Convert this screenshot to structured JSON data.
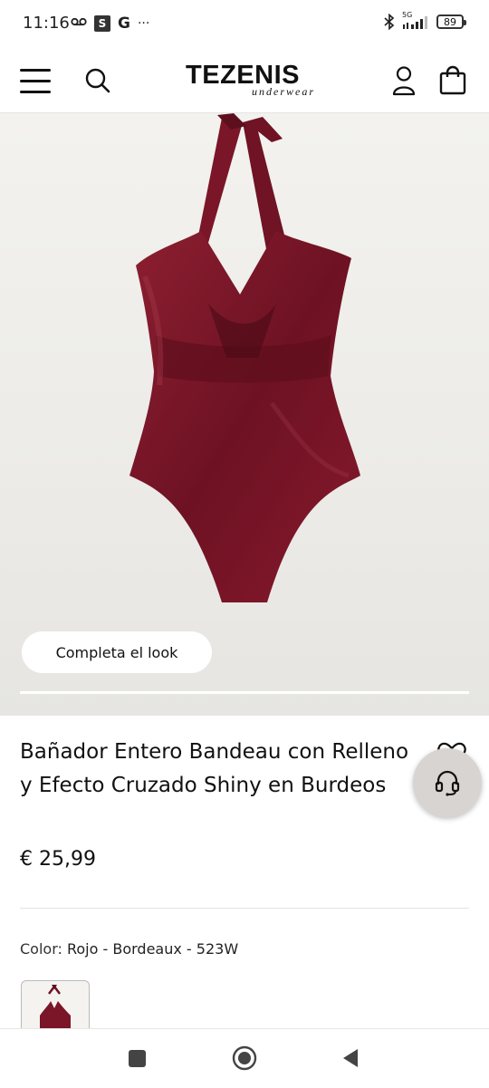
{
  "status_bar": {
    "time": "11:16",
    "icons_left": [
      "voicemail-icon",
      "s-app-icon",
      "google-icon",
      "more-icon"
    ],
    "s_label": "S",
    "g_label": "G",
    "more": "···",
    "network": "5G",
    "battery": "89"
  },
  "header": {
    "logo_main": "TEZENIS",
    "logo_sub": "underwear",
    "icons": [
      "menu-icon",
      "search-icon",
      "user-icon",
      "shopping-bag-icon"
    ]
  },
  "gallery": {
    "complete_look_label": "Completa el look",
    "product_color": "#7a1a2a"
  },
  "product": {
    "title": "Bañador Entero Bandeau con Relleno y Efecto Cruzado Shiny en Burdeos",
    "price": "€ 25,99",
    "color_label": "Color:",
    "color_value": "Rojo - Bordeaux - 523W"
  },
  "colors": {
    "accent": "#7a1a2a",
    "support_button": "#d8d4d2"
  },
  "navbar": {
    "icons": [
      "recent-apps-icon",
      "home-icon",
      "back-icon"
    ]
  }
}
